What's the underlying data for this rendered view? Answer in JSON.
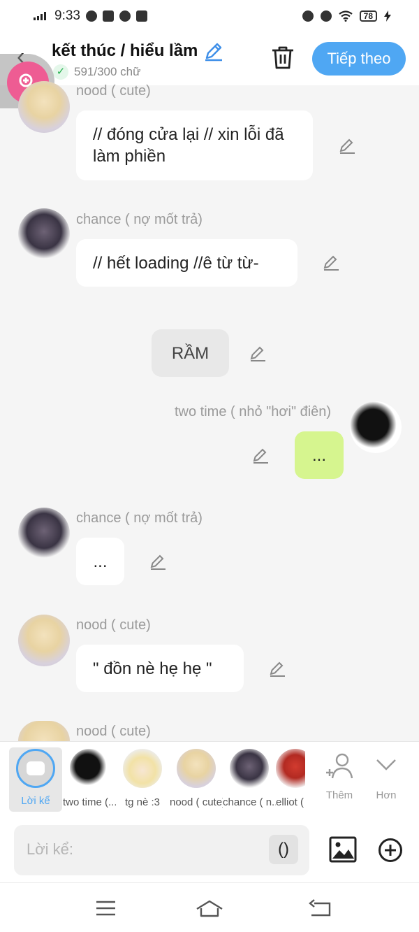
{
  "status_bar": {
    "time": "9:33",
    "battery": "78"
  },
  "header": {
    "title": "kết thúc / hiểu lầm",
    "word_count": "591/300 chữ",
    "next_label": "Tiếp theo"
  },
  "messages": [
    {
      "speaker": "nood ( cute)",
      "text": "// đóng cửa lại // xin lỗi đã làm phiền"
    },
    {
      "speaker": "chance ( nợ mốt trả)",
      "text": "// hết loading //ê từ từ-"
    },
    {
      "speaker": "",
      "text": "RẦM"
    },
    {
      "speaker": "two time ( nhỏ \"hơi\" điên)",
      "text": "..."
    },
    {
      "speaker": "chance ( nợ mốt trả)",
      "text": "..."
    },
    {
      "speaker": "nood ( cute)",
      "text": "\" đồn nè hẹ hẹ  \""
    },
    {
      "speaker": "nood ( cute)",
      "text": ""
    }
  ],
  "characters": [
    {
      "label": "Lời kể",
      "active": true
    },
    {
      "label": "two time (..."
    },
    {
      "label": "tg nè :3"
    },
    {
      "label": "nood ( cute)"
    },
    {
      "label": "chance ( n..."
    },
    {
      "label": "elliot ("
    }
  ],
  "char_actions": {
    "add_label": "Thêm",
    "more_label": "Hơn"
  },
  "composer": {
    "placeholder": "Lời kể:",
    "paren_label": "()"
  },
  "colors": {
    "accent": "#4fa7f3",
    "zoom": "#ee5c93",
    "own_bubble": "#d6f58f"
  }
}
